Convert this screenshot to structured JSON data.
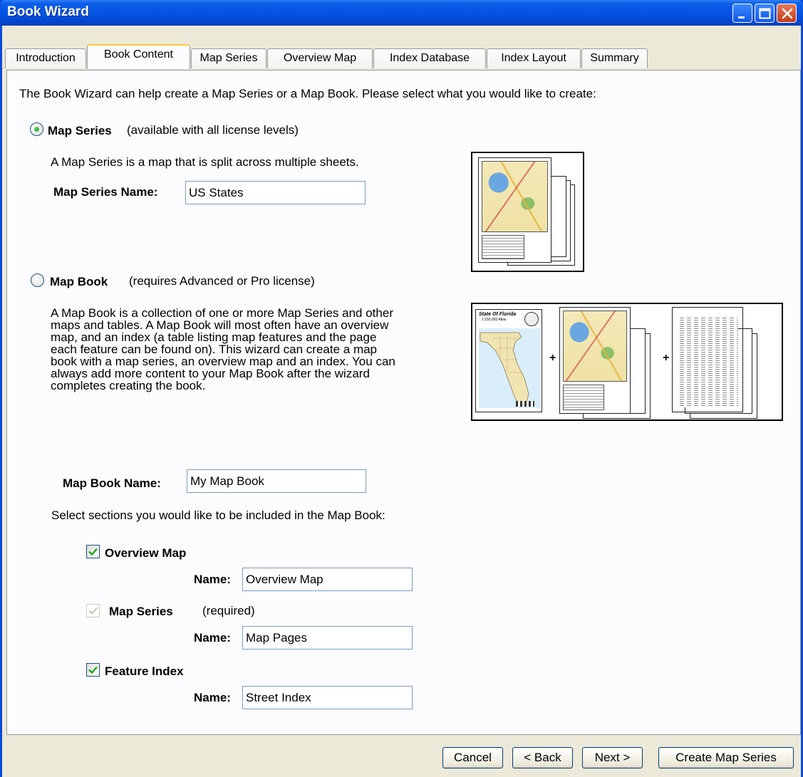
{
  "window": {
    "title": "Book Wizard"
  },
  "tabs": [
    {
      "label": "Introduction"
    },
    {
      "label": "Book Content"
    },
    {
      "label": "Map Series"
    },
    {
      "label": "Overview Map"
    },
    {
      "label": "Index Database"
    },
    {
      "label": "Index Layout"
    },
    {
      "label": "Summary"
    }
  ],
  "active_tab": "Book Content",
  "content": {
    "intro": "The Book Wizard can help create a Map Series or a Map Book.  Please select what you would like to create:",
    "map_series_option": {
      "label": "Map Series",
      "note": "(available with all license levels)",
      "selected": true,
      "description": "A Map Series is a map that is split across multiple sheets.",
      "name_label": "Map Series Name:",
      "name_value": "US States"
    },
    "map_book_option": {
      "label": "Map Book",
      "note": "(requires Advanced or Pro license)",
      "selected": false,
      "description": "A Map Book is a collection of one or more Map Series and other maps and tables.  A Map Book will most often have an overview map, and an index (a table listing map features and the page each feature can be found on).  This wizard can create a map book with a map series, an overview map and an index.  You can always add more content to your Map Book after the wizard completes creating the book.",
      "name_label": "Map Book Name:",
      "name_value": "My Map Book"
    },
    "sections_prompt": "Select sections you would like to be included in the Map Book:",
    "sections": {
      "overview": {
        "label": "Overview Map",
        "checked": true,
        "name_label": "Name:",
        "name_value": "Overview Map"
      },
      "series": {
        "label": "Map Series",
        "note": "(required)",
        "checked": true,
        "disabled": true,
        "name_label": "Name:",
        "name_value": "Map Pages"
      },
      "index": {
        "label": "Feature Index",
        "checked": true,
        "name_label": "Name:",
        "name_value": "Street Index"
      }
    },
    "illustration": {
      "plus": "+",
      "overview_title": "State Of Florida",
      "overview_subtitle": "1:150,000 Atlas"
    }
  },
  "buttons": {
    "cancel": "Cancel",
    "back": "< Back",
    "next": "Next >",
    "create": "Create Map Series"
  },
  "colors": {
    "titlebar": "#0554e2",
    "dialog_bg": "#ece9d8",
    "panel_bg": "#fcfcfe",
    "active_tab_accent": "#ffc83c",
    "check_green": "#21a121"
  }
}
